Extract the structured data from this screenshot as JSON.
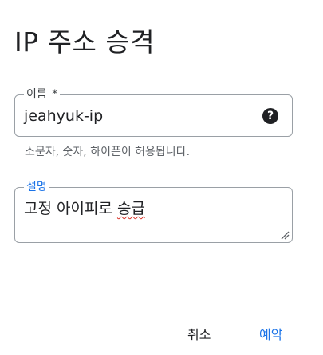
{
  "dialog": {
    "title": "IP 주소 승격"
  },
  "name_field": {
    "label": "이름",
    "required_mark": "*",
    "value": "jeahyuk-ip",
    "help_icon": "help-circle-icon",
    "hint": "소문자, 숫자, 하이픈이 허용됩니다."
  },
  "description_field": {
    "label": "설명",
    "value_plain": "고정 아이피로 ",
    "value_misspelled": "승급"
  },
  "actions": {
    "cancel": "취소",
    "reserve": "예약"
  },
  "colors": {
    "accent": "#1a73e8",
    "border": "#9aa0a6",
    "spellcheck": "#d93025"
  }
}
